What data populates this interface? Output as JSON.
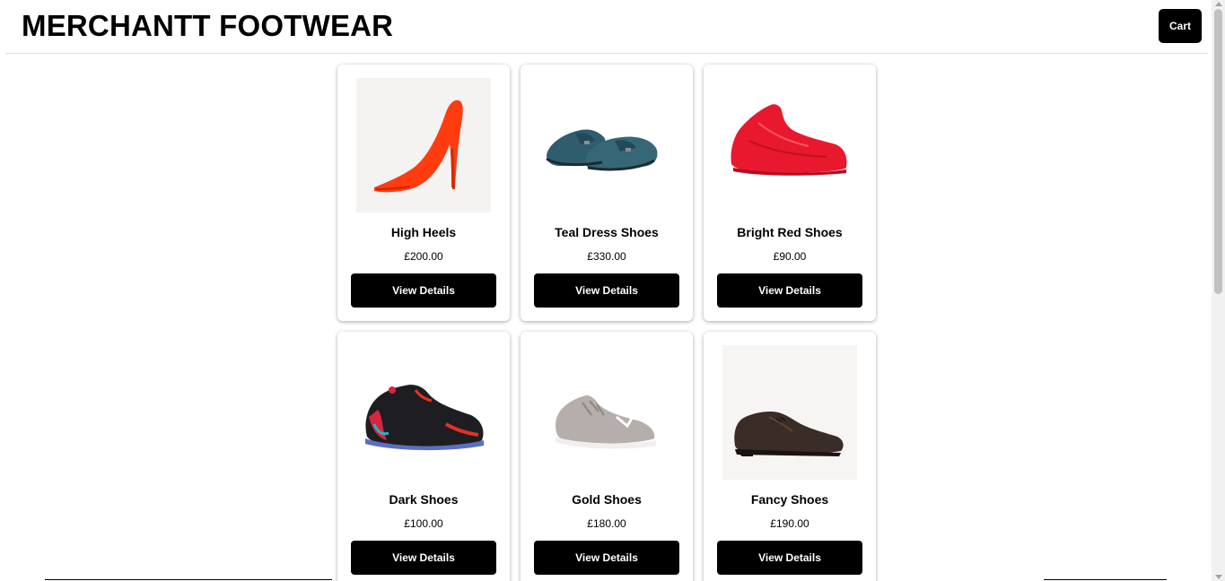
{
  "header": {
    "brand": "MERCHANTT FOOTWEAR",
    "cart_label": "Cart"
  },
  "products": [
    {
      "name": "High Heels",
      "price": "£200.00",
      "button": "View Details",
      "icon": "high-heel-shoe-icon",
      "color": "#ff3b10"
    },
    {
      "name": "Teal Dress Shoes",
      "price": "£330.00",
      "button": "View Details",
      "icon": "loafer-shoe-icon",
      "color": "#2f5d6e"
    },
    {
      "name": "Bright Red Shoes",
      "price": "£90.00",
      "button": "View Details",
      "icon": "red-sneaker-icon",
      "color": "#e8182f"
    },
    {
      "name": "Dark Shoes",
      "price": "£100.00",
      "button": "View Details",
      "icon": "black-sneaker-icon",
      "color": "#1e1e22"
    },
    {
      "name": "Gold Shoes",
      "price": "£180.00",
      "button": "View Details",
      "icon": "grey-trainer-icon",
      "color": "#b5aeab"
    },
    {
      "name": "Fancy Shoes",
      "price": "£190.00",
      "button": "View Details",
      "icon": "oxford-shoe-icon",
      "color": "#3a2c26"
    }
  ]
}
